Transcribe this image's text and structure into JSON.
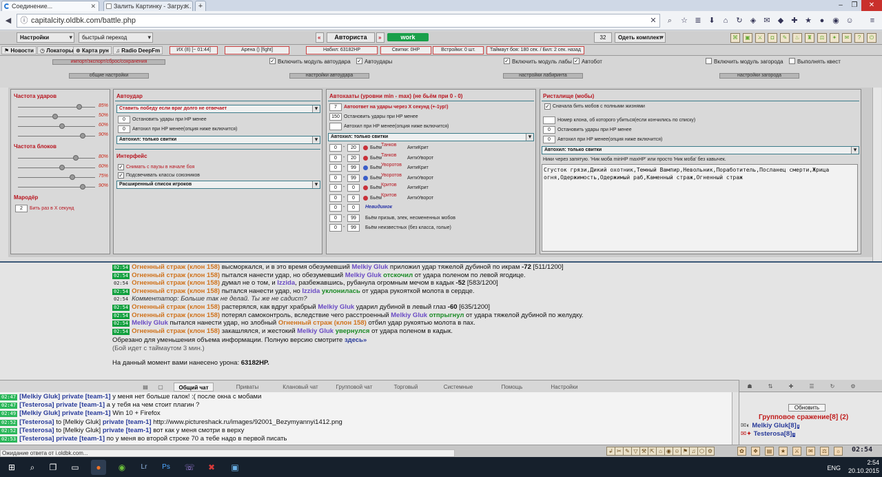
{
  "browser": {
    "tabs": [
      {
        "title": "Соединение...",
        "active": true
      },
      {
        "title": "Залить Картинку - Загруз...",
        "active": false
      }
    ],
    "url": "capitalcity.oldbk.com/battle.php",
    "close_glyph": "✕",
    "search_glyph": "⌕"
  },
  "topbar": {
    "settings": "Настройки",
    "quick_jump": "быстрый переход",
    "prev": "«",
    "next": "»",
    "nick": "Авториста",
    "work": "work",
    "counter": "32",
    "outfit": "Одеть комплект"
  },
  "nav": {
    "items": [
      {
        "icon": "news-icon",
        "label": "Новости"
      },
      {
        "icon": "locator-icon",
        "label": "Локаторы"
      },
      {
        "icon": "runes-map-icon",
        "label": "Карта рун"
      },
      {
        "icon": "radio-icon",
        "label": "Radio DeepFm"
      }
    ],
    "stats": [
      "ИХ (8) [~ 01:44]",
      "Арена () [fight]",
      "Набил: 63182HP",
      "Свитки: 0HP",
      "Встройки: 0 шт.",
      "Таймаут боя: 180 сек. / Бил: 2 сек. назад"
    ]
  },
  "options": {
    "import_export": "импорт/экспорт/сброс/сохранения",
    "checks": [
      {
        "label": "Включить модуль автоудара",
        "checked": true
      },
      {
        "label": "Автоудары",
        "checked": true
      },
      {
        "label": "Включить модуль лабы",
        "checked": true
      },
      {
        "label": "Автобот",
        "checked": true
      },
      {
        "label": "Включить модуль загорода",
        "checked": false
      },
      {
        "label": "Выполнять квест",
        "checked": false
      }
    ],
    "sections": [
      "общие настройки",
      "настройки автоудара",
      "настройки лабиринта",
      "настройки загорода"
    ]
  },
  "panel_freq": {
    "hit_title": "Частота ударов",
    "hit_pcts": [
      "85%",
      "50%",
      "60%",
      "90%"
    ],
    "hit_levels": [
      0.85,
      0.5,
      0.6,
      0.9
    ],
    "block_title": "Частота блоков",
    "block_pcts": [
      "80%",
      "60%",
      "75%",
      "90%"
    ],
    "block_levels": [
      0.8,
      0.6,
      0.75,
      0.9
    ],
    "marauder_title": "Мародёр",
    "marauder_value": "2",
    "marauder_label": "Бить раз в X секунд"
  },
  "panel_autohit": {
    "title": "Автоудар",
    "dropdown1": "Ставить победу если враг долго не отвечает",
    "stop_value": "0",
    "stop_label": "Остановить удары при HP менее",
    "autoheal_value": "0",
    "autoheal_label": "Автохил при HP менее(опция ниже включится)",
    "dropdown2": "Автохил: только свитки",
    "interface_title": "Интерфейс",
    "interface_checks": [
      {
        "label": "Снимать с паузы в начале боя",
        "checked": true
      },
      {
        "label": "Подсвечивать классы союзников",
        "checked": true
      }
    ],
    "dropdown3": "Расширенный список игроков"
  },
  "panel_autocast": {
    "title": "Автохааты (уровни min - max) (не бьём при 0 - 0)",
    "reply_value": "7",
    "reply_label": "Автоответ на удары через X секунд (+-1ур!)",
    "stop_value": "150",
    "stop_label": "Остановить удары при HP менее",
    "autoheal_label": "Автохил при HP менее(опция ниже включится)",
    "dropdown": "Автохил: только свитки",
    "rows": [
      {
        "min": "0",
        "max": "20",
        "beat": "Бьём",
        "cls": "Танков",
        "anti": "АнтиКрит",
        "orb": "#c8323a"
      },
      {
        "min": "0",
        "max": "20",
        "beat": "Бьём",
        "cls": "Танков",
        "anti": "АнтиУворот",
        "orb": "#c8323a"
      },
      {
        "min": "0",
        "max": "99",
        "beat": "Бьём",
        "cls": "Уворотов",
        "anti": "АнтиКрит",
        "orb": "#3a5fc8"
      },
      {
        "min": "0",
        "max": "99",
        "beat": "Бьём",
        "cls": "Уворотов",
        "anti": "АнтиУворот",
        "orb": "#3a5fc8"
      },
      {
        "min": "0",
        "max": "0",
        "beat": "Бьём",
        "cls": "Критов",
        "anti": "АнтиКрит",
        "orb": "#c8323a"
      },
      {
        "min": "0",
        "max": "0",
        "beat": "Бьём",
        "cls": "Критов",
        "anti": "АнтиУворот",
        "orb": "#c8323a"
      },
      {
        "min": "0",
        "max": "0",
        "beat": "",
        "cls": "Невидимок",
        "anti": "",
        "orb": ""
      },
      {
        "min": "0",
        "max": "99",
        "beat": "Бьём призыв, элек, несмененных мобов",
        "cls": "",
        "anti": "",
        "orb": ""
      },
      {
        "min": "0",
        "max": "99",
        "beat": "Бьём неизвестных (без класса, голые)",
        "cls": "",
        "anti": "",
        "orb": ""
      }
    ]
  },
  "panel_arena": {
    "title": "Ристалище (мобы)",
    "first_check": "Сначала бить мобов с полными жизнями",
    "clone_label": "Номер клона, об которого убиться(если кончились по списку)",
    "stop_value": "0",
    "stop_label": "Остановить удары при HP менее",
    "autoheal_value": "0",
    "autoheal_label": "Автохил при HP менее(опция ниже включится)",
    "dropdown": "Автохил: только свитки",
    "hint": "Ники через запятую. 'Ник моба minHP maxHP' или просто 'Ник моба' без кавычек.",
    "list": "Сгусток грязи,Дикий охотник,Темный Вампир,Невольник,Поработитель,Посланец смерти,Жрица огня,Одержимость,Одержимый раб,Каменный страж,Огненный страж"
  },
  "log": {
    "lines": [
      {
        "ts": "02:54",
        "green": true,
        "parts": [
          [
            "en",
            "Огненный страж (клон 158)"
          ],
          [
            "t",
            " высморкался, и в это время обезумевший "
          ],
          [
            "me",
            "Melkiy Gluk"
          ],
          [
            "t",
            " приложил удар тяжелой дубиной по икрам "
          ],
          [
            "b",
            "-72"
          ],
          [
            "t",
            " [511/1200]"
          ]
        ]
      },
      {
        "ts": "02:54",
        "green": true,
        "parts": [
          [
            "en",
            "Огненный страж (клон 158)"
          ],
          [
            "t",
            " пытался нанести удар, но обезумевший "
          ],
          [
            "me",
            "Melkiy Gluk"
          ],
          [
            "t",
            " "
          ],
          [
            "gr",
            "отскочил"
          ],
          [
            "t",
            " от удара поленом по левой ягодице."
          ]
        ]
      },
      {
        "ts": "02:54",
        "green": false,
        "parts": [
          [
            "en",
            "Огненный страж (клон 158)"
          ],
          [
            "t",
            " думал не о том, и "
          ],
          [
            "me",
            "Izzida"
          ],
          [
            "t",
            ", разбежавшись, рубанула огромным мечом в кадык "
          ],
          [
            "b",
            "-52"
          ],
          [
            "t",
            " [583/1200]"
          ]
        ]
      },
      {
        "ts": "02:54",
        "green": true,
        "parts": [
          [
            "en",
            "Огненный страж (клон 158)"
          ],
          [
            "t",
            " пытался нанести удар, но "
          ],
          [
            "me",
            "Izzida"
          ],
          [
            "t",
            " "
          ],
          [
            "gr",
            "уклонилась"
          ],
          [
            "t",
            " от удара рукояткой молота в сердце."
          ]
        ]
      },
      {
        "ts": "02:54",
        "green": false,
        "parts": [
          [
            "i",
            "Комментатор: Больше так не делай. Ты же не садист?"
          ]
        ]
      },
      {
        "ts": "02:54",
        "green": true,
        "parts": [
          [
            "en",
            "Огненный страж (клон 158)"
          ],
          [
            "t",
            " растерялся, как вдруг храбрый "
          ],
          [
            "me",
            "Melkiy Gluk"
          ],
          [
            "t",
            " ударил дубиной в левый глаз "
          ],
          [
            "b",
            "-60"
          ],
          [
            "t",
            " [635/1200]"
          ]
        ]
      },
      {
        "ts": "02:54",
        "green": true,
        "parts": [
          [
            "en",
            "Огненный страж (клон 158)"
          ],
          [
            "t",
            " потерял самоконтроль, вследствие чего расстроенный "
          ],
          [
            "me",
            "Melkiy Gluk"
          ],
          [
            "t",
            " "
          ],
          [
            "gr",
            "отпрыгнул"
          ],
          [
            "t",
            " от удара тяжелой дубиной по желудку."
          ]
        ]
      },
      {
        "ts": "02:54",
        "green": true,
        "parts": [
          [
            "me",
            "Melkiy Gluk"
          ],
          [
            "t",
            " пытался нанести удар, но злобный "
          ],
          [
            "en",
            "Огненный страж (клон 158)"
          ],
          [
            "t",
            " отбил удар рукоятью молота в пах."
          ]
        ]
      },
      {
        "ts": "02:54",
        "green": true,
        "parts": [
          [
            "en",
            "Огненный страж (клон 158)"
          ],
          [
            "t",
            " закашлялся, и жестокий "
          ],
          [
            "me",
            "Melkiy Gluk"
          ],
          [
            "t",
            " "
          ],
          [
            "gr",
            "увернулся"
          ],
          [
            "t",
            " от удара поленом в кадык."
          ]
        ]
      }
    ],
    "trimmed": "Обрезано для уменьшения объема информации. Полную версию смотрите ",
    "here_link": "здесь»",
    "timeout": "(Бой идет с таймаутом 3 мин.)",
    "damage_prefix": "На данный момент вами нанесено урона: ",
    "damage_value": "63182HP."
  },
  "chat": {
    "tabs": [
      "Общий чат",
      "Приваты",
      "Клановый чат",
      "Групповой чат",
      "Торговый",
      "Системные",
      "Помощь",
      "Настройки"
    ],
    "lines": [
      {
        "ts": "02:47",
        "nick": "[Melkiy Gluk]",
        "mode": "private [team-1]",
        "text": "у меня нет больше галок! :( после окна с мобами"
      },
      {
        "ts": "02:47",
        "nick": "[Testerosa]",
        "mode": "private [team-1]",
        "text": "а у тебя на чем стоит плагин ?"
      },
      {
        "ts": "02:49",
        "nick": "[Melkiy Gluk]",
        "mode": "private [team-1]",
        "text": "Win 10 + Firefox"
      },
      {
        "ts": "02:52",
        "nick": "[Testerosa]",
        "to": "to [Melkiy Gluk]",
        "mode": "private [team-1]",
        "text": "http://www.pictureshack.ru/images/92001_Bezymyannyi1412.png"
      },
      {
        "ts": "02:52",
        "nick": "[Testerosa]",
        "to": "to [Melkiy Gluk]",
        "mode": "private [team-1]",
        "text": "вот как у меня смотри в верху"
      },
      {
        "ts": "02:53",
        "nick": "[Testerosa]",
        "mode": "private [team-1]",
        "text": "по у меня во второй строке 70 а тебе надо в первой писать"
      }
    ]
  },
  "group": {
    "refresh": "Обновить",
    "title": "Групповое сражение[8] (2)",
    "members": [
      "Melkiy Gluk[8]",
      "Testerosa[8]"
    ]
  },
  "status": {
    "text": "Ожидание ответа от i.oldbk.com...",
    "clock": "02:54"
  },
  "taskbar": {
    "time": "2:54",
    "date": "20.10.2015",
    "lang": "ENG"
  }
}
